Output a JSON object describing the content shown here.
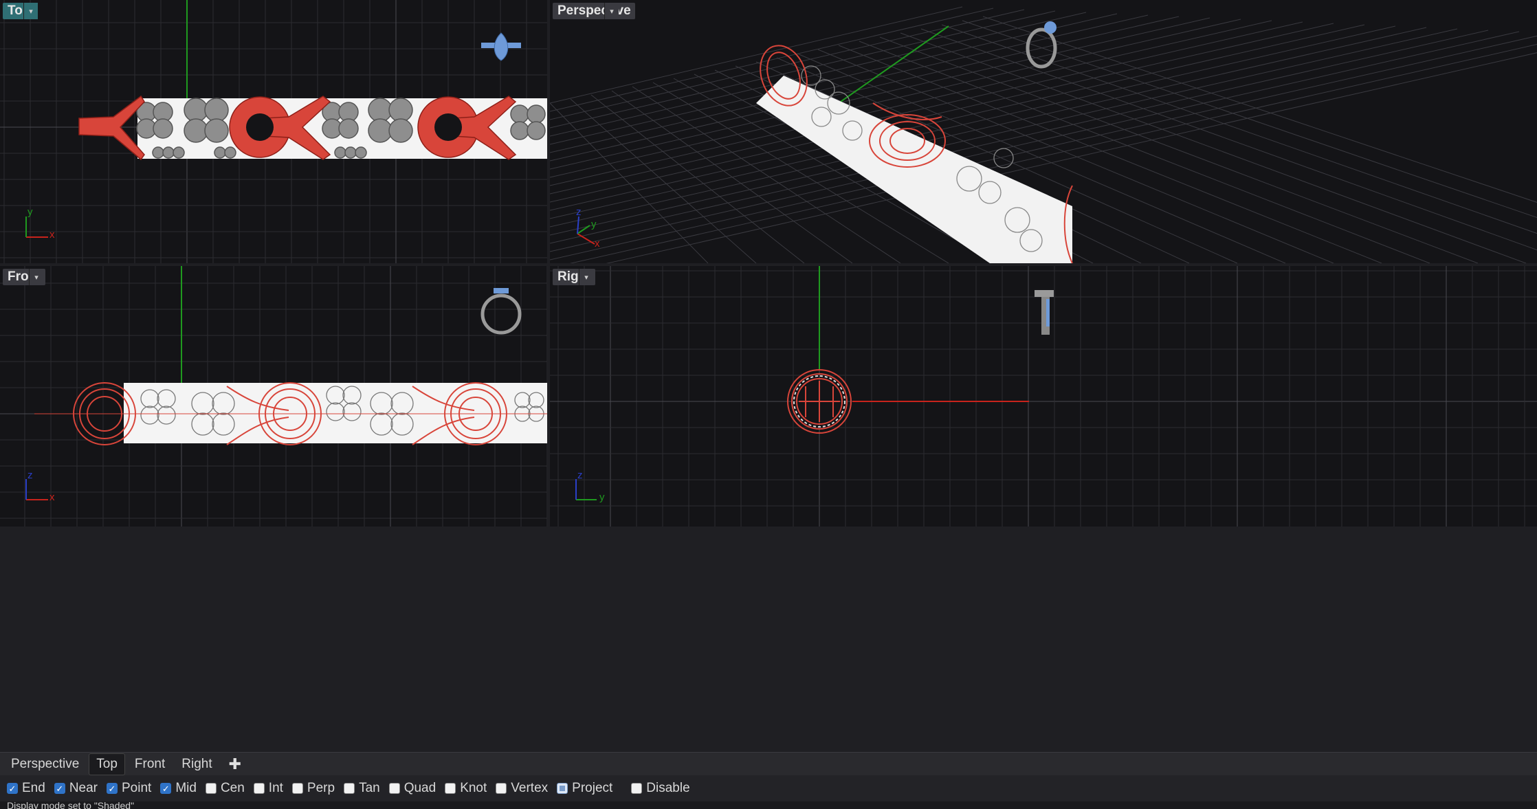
{
  "viewports": {
    "top": {
      "label": "Top"
    },
    "perspective": {
      "label": "Perspective"
    },
    "front": {
      "label": "Front"
    },
    "right": {
      "label": "Right"
    }
  },
  "axes": {
    "top": {
      "a": "y",
      "b": "x"
    },
    "perspective": {
      "a": "z",
      "b": "y",
      "c": "x"
    },
    "front": {
      "a": "z",
      "b": "x"
    },
    "right": {
      "a": "z",
      "b": "y"
    }
  },
  "tabs": [
    {
      "label": "Perspective"
    },
    {
      "label": "Top"
    },
    {
      "label": "Front"
    },
    {
      "label": "Right"
    }
  ],
  "active_tab": "Top",
  "add_tab_symbol": "✚",
  "osnaps": [
    {
      "label": "End",
      "state": "on"
    },
    {
      "label": "Near",
      "state": "on"
    },
    {
      "label": "Point",
      "state": "on"
    },
    {
      "label": "Mid",
      "state": "on"
    },
    {
      "label": "Cen",
      "state": "off"
    },
    {
      "label": "Int",
      "state": "off"
    },
    {
      "label": "Perp",
      "state": "off"
    },
    {
      "label": "Tan",
      "state": "off"
    },
    {
      "label": "Quad",
      "state": "off"
    },
    {
      "label": "Knot",
      "state": "off"
    },
    {
      "label": "Vertex",
      "state": "off"
    },
    {
      "label": "Project",
      "state": "partial"
    },
    {
      "label": "Disable",
      "state": "off"
    }
  ],
  "command_line": "Display mode set to \"Shaded\"",
  "colors": {
    "viewport_bg": "#141417",
    "grid_minor": "#2c2c30",
    "grid_major": "#4a4a50",
    "axis_x": "#c8231c",
    "axis_y": "#1f9a1f",
    "model_red": "#d8453a",
    "model_gray": "#9a9a9a",
    "gem_blue": "#6e9ad8",
    "active_label": "#2f6f74"
  }
}
